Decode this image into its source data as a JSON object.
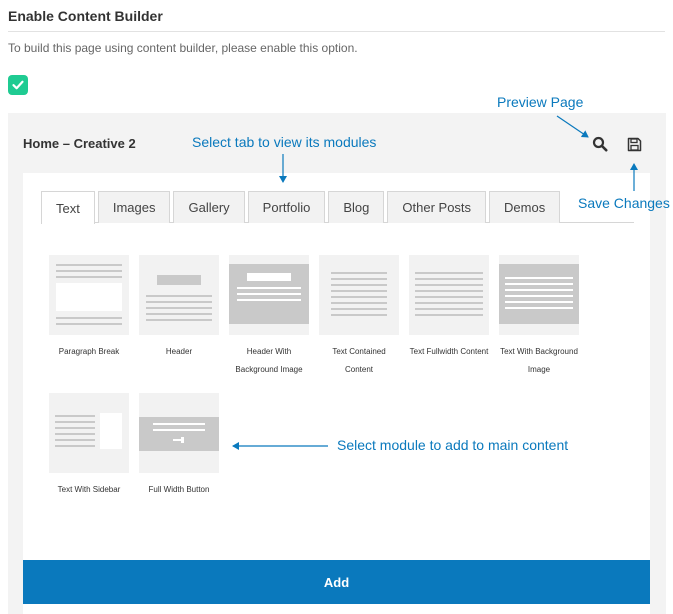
{
  "settings": {
    "title": "Enable Content Builder",
    "description": "To build this page using content builder, please enable this option.",
    "enabled": true
  },
  "builder": {
    "page_title": "Home – Creative 2",
    "icons": {
      "preview": "search-icon",
      "save": "save-icon"
    },
    "tabs": [
      {
        "label": "Text",
        "active": true
      },
      {
        "label": "Images",
        "active": false
      },
      {
        "label": "Gallery",
        "active": false
      },
      {
        "label": "Portfolio",
        "active": false
      },
      {
        "label": "Blog",
        "active": false
      },
      {
        "label": "Other Posts",
        "active": false
      },
      {
        "label": "Demos",
        "active": false
      }
    ],
    "modules": [
      {
        "label": "Paragraph Break"
      },
      {
        "label": "Header"
      },
      {
        "label": "Header With Background Image"
      },
      {
        "label": "Text Contained Content"
      },
      {
        "label": "Text Fullwidth Content"
      },
      {
        "label": "Text With Background Image"
      },
      {
        "label": "Text With Sidebar"
      },
      {
        "label": "Full Width Button"
      }
    ],
    "add_label": "Add"
  },
  "annotations": {
    "preview": "Preview Page",
    "tabs": "Select tab to view its modules",
    "save": "Save Changes",
    "module": "Select module to add to main content"
  },
  "colors": {
    "accent": "#0a79bd",
    "checkbox": "#1fcb92"
  }
}
